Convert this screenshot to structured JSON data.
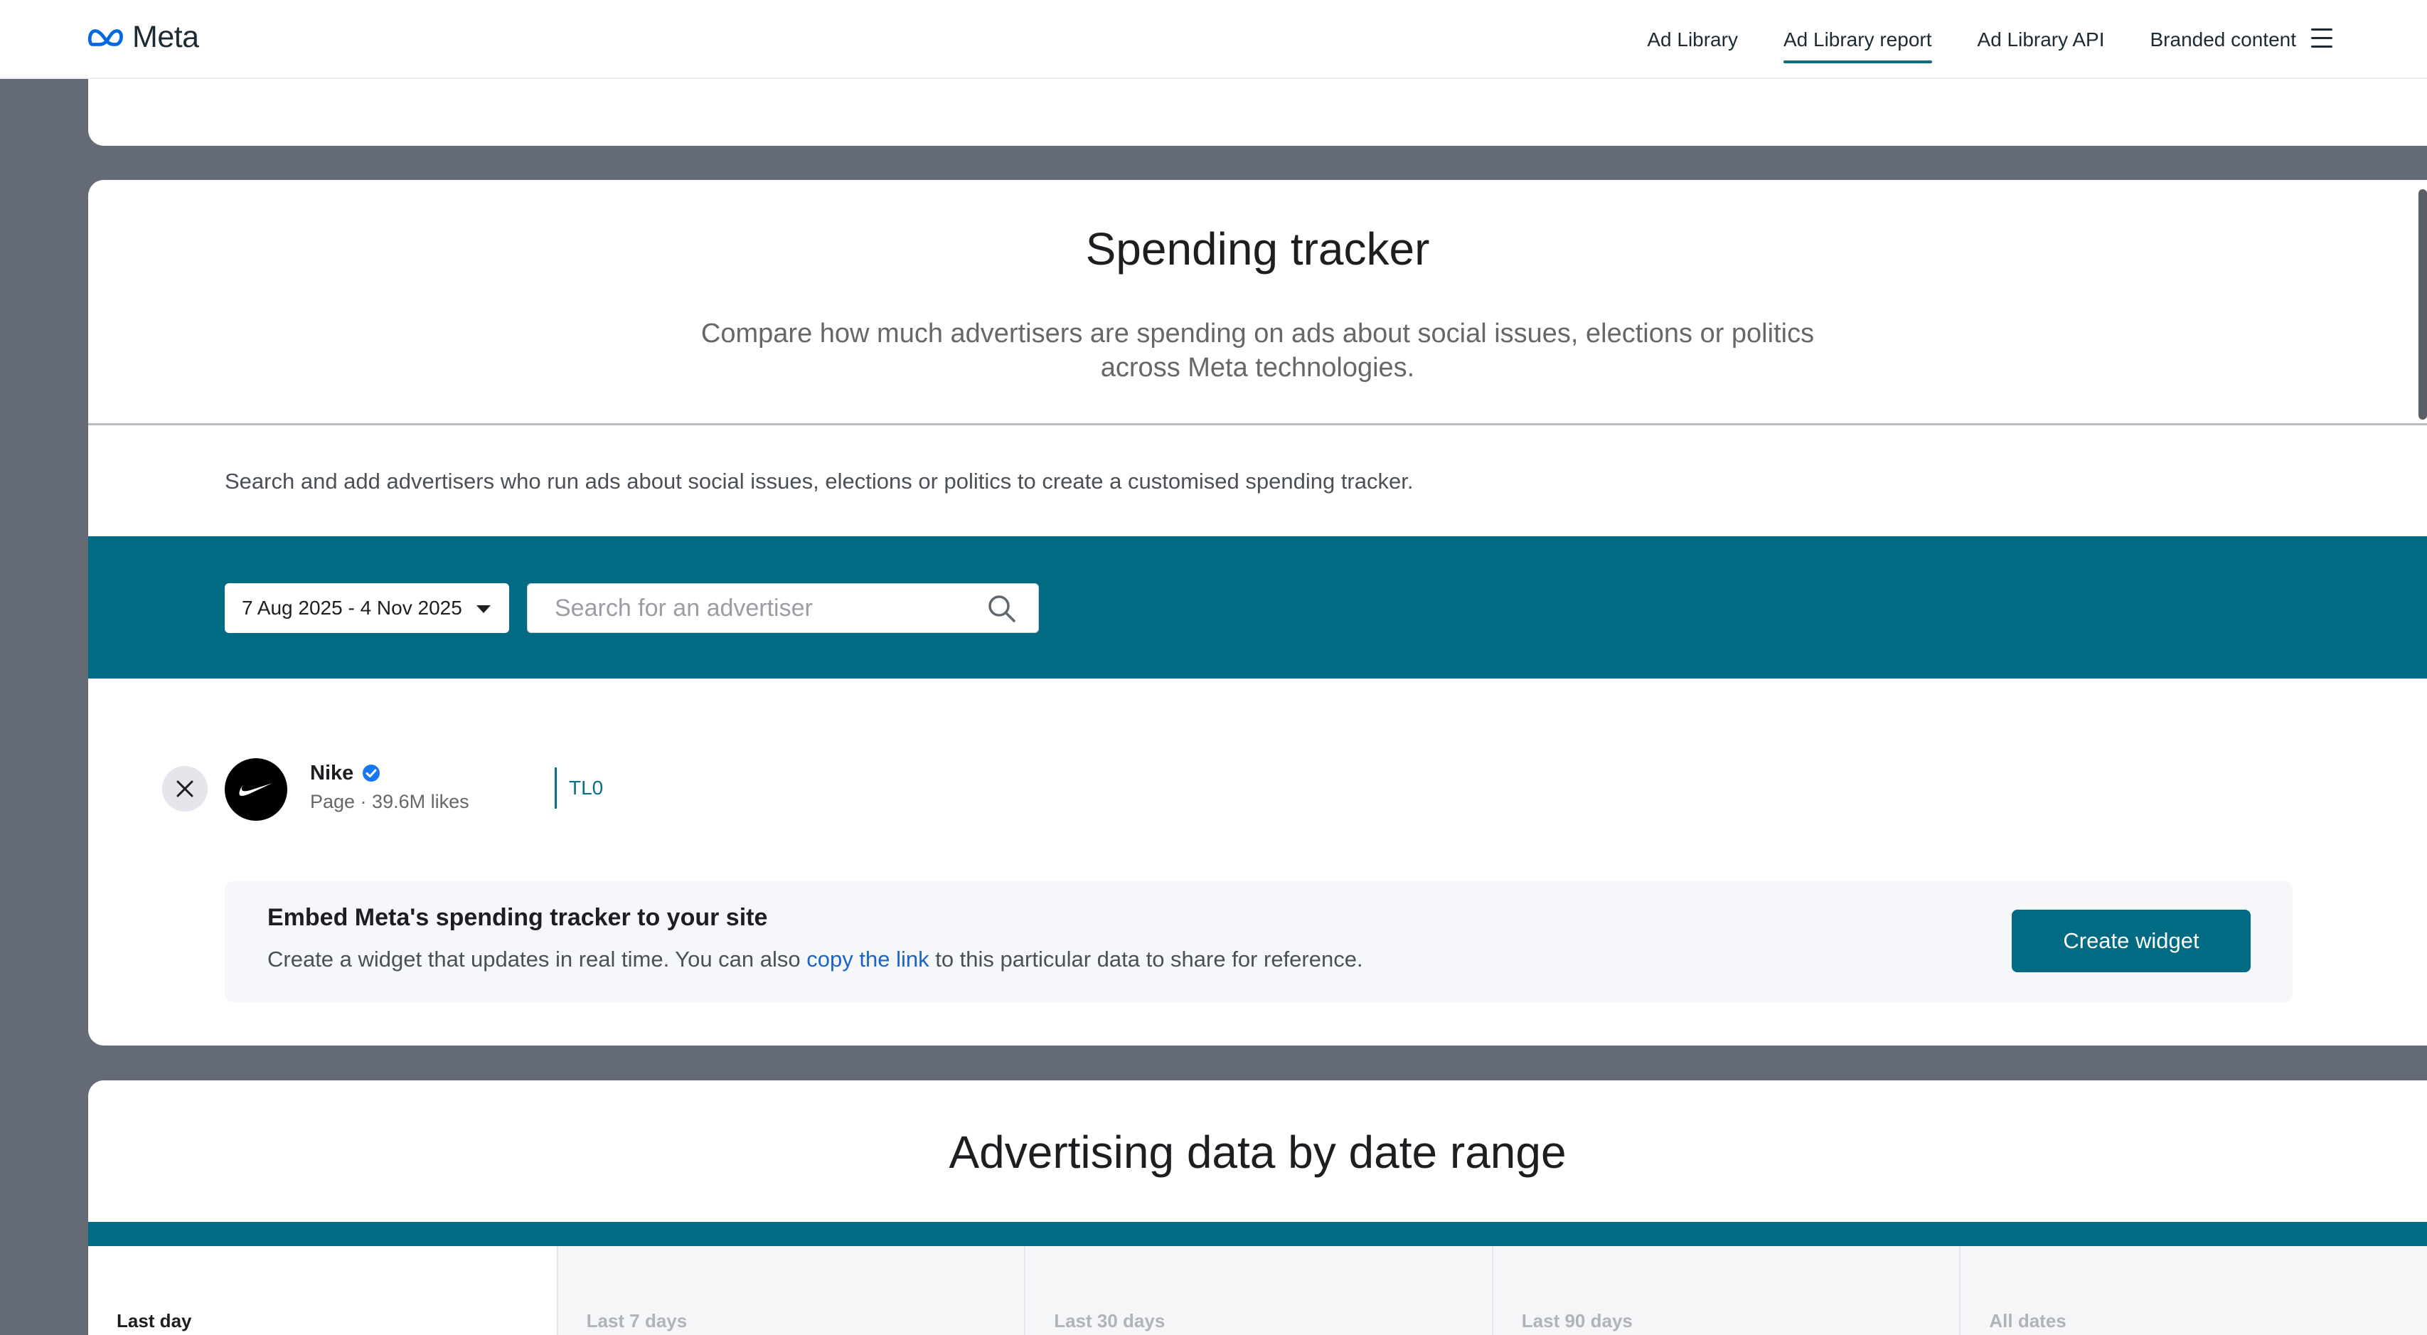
{
  "brand": {
    "name": "Meta",
    "logo_icon": "meta-infinity-logo",
    "accent": "#006b82"
  },
  "nav": {
    "links": [
      {
        "label": "Ad Library",
        "active": false
      },
      {
        "label": "Ad Library report",
        "active": true
      },
      {
        "label": "Ad Library API",
        "active": false
      },
      {
        "label": "Branded content",
        "active": false
      }
    ],
    "menu_icon": "hamburger-menu-icon"
  },
  "tracker": {
    "title": "Spending tracker",
    "subtitle_line1": "Compare how much advertisers are spending on ads about social issues, elections or politics",
    "subtitle_line2": "across Meta technologies.",
    "helper": "Search and add advertisers who run ads about social issues, elections or politics to create a customised spending tracker.",
    "date_range": "7 Aug 2025 - 4 Nov 2025",
    "search_placeholder": "Search for an advertiser",
    "advertiser": {
      "name": "Nike",
      "verified": true,
      "meta": "Page · 39.6M likes",
      "tag": "TL0"
    },
    "embed": {
      "title": "Embed Meta's spending tracker to your site",
      "text_before": "Create a widget that updates in real time. You can also ",
      "link": "copy the link",
      "text_after": " to this particular data to share for reference.",
      "button": "Create widget"
    }
  },
  "date_range_section": {
    "title": "Advertising data by date range",
    "tabs": [
      "Last day",
      "Last 7 days",
      "Last 30 days",
      "Last 90 days",
      "All dates"
    ]
  }
}
